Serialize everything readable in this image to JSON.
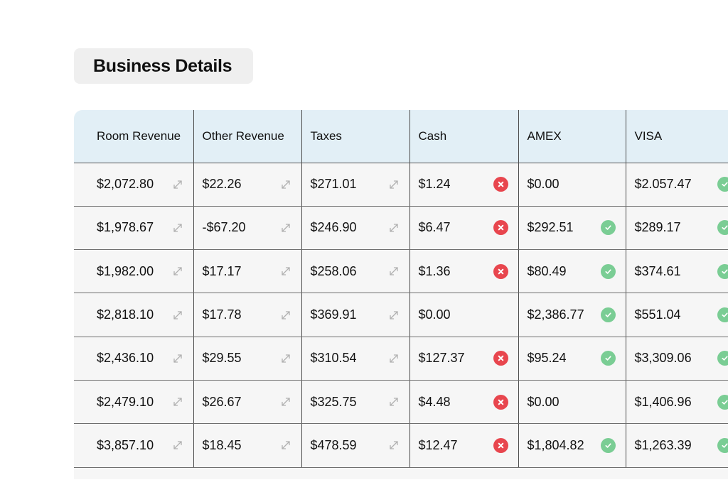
{
  "page": {
    "title": "Business Details"
  },
  "colors": {
    "header_bg": "#e2eff6",
    "row_bg": "#f6f6f6",
    "error": "#e8464e",
    "ok": "#7acd94",
    "expand_icon": "#b0b0b0"
  },
  "table": {
    "columns": [
      "Room Revenue",
      "Other Revenue",
      "Taxes",
      "Cash",
      "AMEX",
      "VISA"
    ],
    "rows": [
      {
        "room_revenue": {
          "value": "$2,072.80",
          "icon": "expand-icon"
        },
        "other_revenue": {
          "value": "$22.26",
          "icon": "expand-icon"
        },
        "taxes": {
          "value": "$271.01",
          "icon": "expand-icon"
        },
        "cash": {
          "value": "$1.24",
          "icon": "error-icon"
        },
        "amex": {
          "value": "$0.00",
          "icon": ""
        },
        "visa": {
          "value": "$2.057.47",
          "icon": "check-icon"
        }
      },
      {
        "room_revenue": {
          "value": "$1,978.67",
          "icon": "expand-icon"
        },
        "other_revenue": {
          "value": "-$67.20",
          "icon": "expand-icon"
        },
        "taxes": {
          "value": "$246.90",
          "icon": "expand-icon"
        },
        "cash": {
          "value": "$6.47",
          "icon": "error-icon"
        },
        "amex": {
          "value": "$292.51",
          "icon": "check-icon"
        },
        "visa": {
          "value": "$289.17",
          "icon": "check-icon"
        }
      },
      {
        "room_revenue": {
          "value": "$1,982.00",
          "icon": "expand-icon"
        },
        "other_revenue": {
          "value": "$17.17",
          "icon": "expand-icon"
        },
        "taxes": {
          "value": "$258.06",
          "icon": "expand-icon"
        },
        "cash": {
          "value": "$1.36",
          "icon": "error-icon"
        },
        "amex": {
          "value": "$80.49",
          "icon": "check-icon"
        },
        "visa": {
          "value": "$374.61",
          "icon": "check-icon"
        }
      },
      {
        "room_revenue": {
          "value": "$2,818.10",
          "icon": "expand-icon"
        },
        "other_revenue": {
          "value": "$17.78",
          "icon": "expand-icon"
        },
        "taxes": {
          "value": "$369.91",
          "icon": "expand-icon"
        },
        "cash": {
          "value": "$0.00",
          "icon": ""
        },
        "amex": {
          "value": "$2,386.77",
          "icon": "check-icon"
        },
        "visa": {
          "value": "$551.04",
          "icon": "check-icon"
        }
      },
      {
        "room_revenue": {
          "value": "$2,436.10",
          "icon": "expand-icon"
        },
        "other_revenue": {
          "value": "$29.55",
          "icon": "expand-icon"
        },
        "taxes": {
          "value": "$310.54",
          "icon": "expand-icon"
        },
        "cash": {
          "value": "$127.37",
          "icon": "error-icon"
        },
        "amex": {
          "value": "$95.24",
          "icon": "check-icon"
        },
        "visa": {
          "value": "$3,309.06",
          "icon": "check-icon"
        }
      },
      {
        "room_revenue": {
          "value": "$2,479.10",
          "icon": "expand-icon"
        },
        "other_revenue": {
          "value": "$26.67",
          "icon": "expand-icon"
        },
        "taxes": {
          "value": "$325.75",
          "icon": "expand-icon"
        },
        "cash": {
          "value": "$4.48",
          "icon": "error-icon"
        },
        "amex": {
          "value": "$0.00",
          "icon": ""
        },
        "visa": {
          "value": "$1,406.96",
          "icon": "check-icon"
        }
      },
      {
        "room_revenue": {
          "value": "$3,857.10",
          "icon": "expand-icon"
        },
        "other_revenue": {
          "value": "$18.45",
          "icon": "expand-icon"
        },
        "taxes": {
          "value": "$478.59",
          "icon": "expand-icon"
        },
        "cash": {
          "value": "$12.47",
          "icon": "error-icon"
        },
        "amex": {
          "value": "$1,804.82",
          "icon": "check-icon"
        },
        "visa": {
          "value": "$1,263.39",
          "icon": "check-icon"
        }
      }
    ]
  }
}
